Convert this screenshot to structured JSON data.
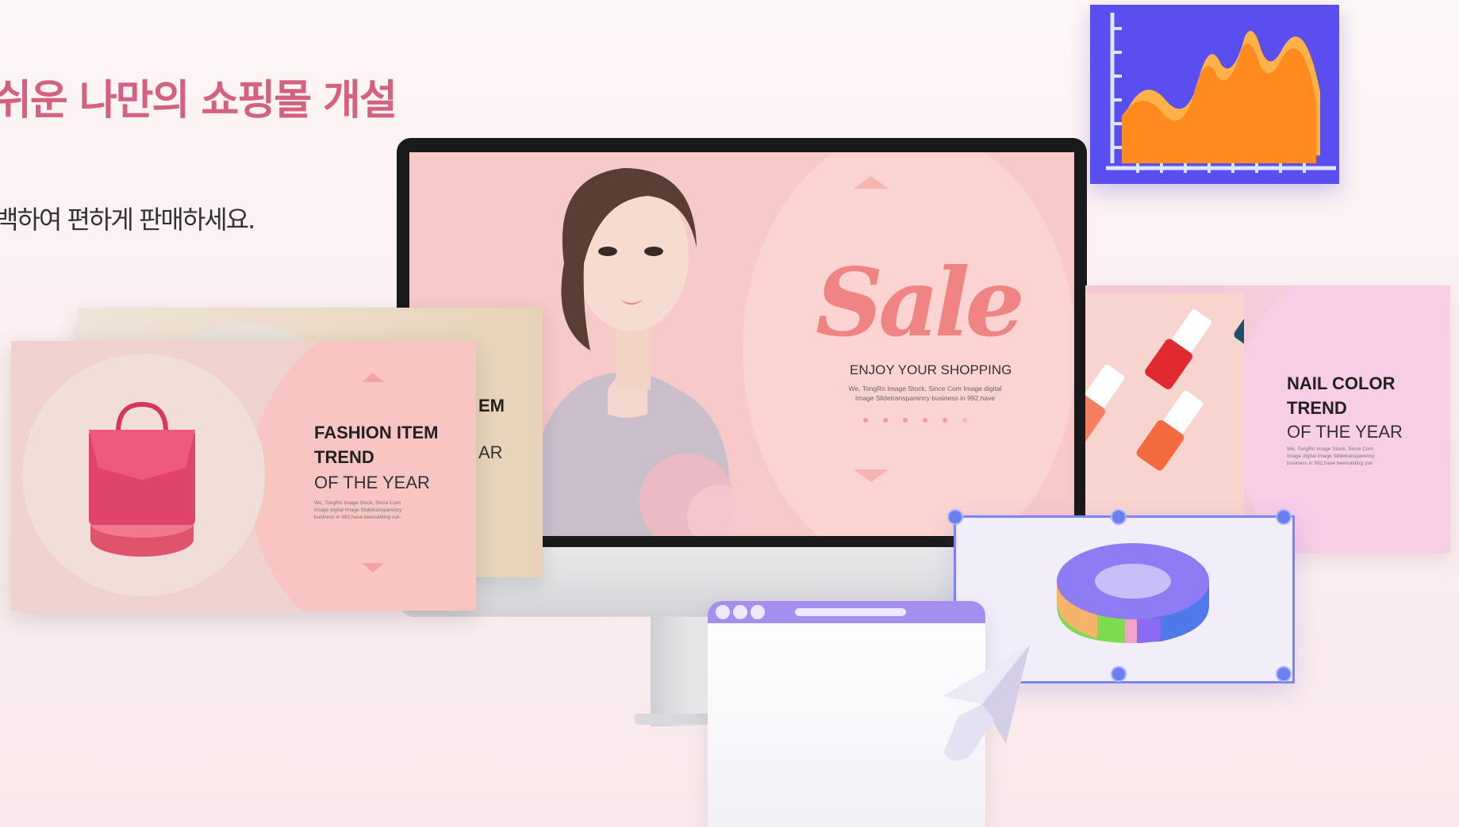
{
  "hero": {
    "headline": "쉬운 나만의 쇼핑몰 개설",
    "subline": "백하여 편하게 판매하세요."
  },
  "monitor_banner": {
    "sale_word": "Sale",
    "tagline": "ENJOY YOUR SHOPPING",
    "copy_line1": "We, TongRo Image Stock, Since Com Image digital",
    "copy_line2": "Image Slidetransparency business in 992,have"
  },
  "slide_back": {
    "title_fragment": "EM",
    "sub_fragment": "AR"
  },
  "slide_fashion": {
    "title_line1": "FASHION ITEM",
    "title_line2": "TREND",
    "subtitle": "OF THE YEAR",
    "copy_line1": "We, TongRo Image Stock, Since Com",
    "copy_line2": "Image digital Image Slidetransparency",
    "copy_line3": "business in 992,have  beenuilding out-"
  },
  "slide_nail": {
    "title_line1": "NAIL COLOR",
    "title_line2": "TREND",
    "subtitle": "OF THE YEAR",
    "copy_line1": "We, TongRo Image Stock, Since Com",
    "copy_line2": "Image digital Image Slidetransparency",
    "copy_line3": "business in 992,have  beenuilding out-"
  },
  "colors": {
    "accent_pink": "#d6607f",
    "sale_pink": "#f08383",
    "chart_bg": "#5b4ef0",
    "chart_fill": "#ff8a1e",
    "donut_segments": [
      "#f6b36a",
      "#7ddc4e",
      "#f2a3c8",
      "#8a6cf2",
      "#4f79ea"
    ]
  },
  "icons": {
    "chart": "area-chart-icon",
    "donut": "donut-chart-icon",
    "cursor": "cursor-arrow-icon",
    "bag": "handbag-icon"
  }
}
